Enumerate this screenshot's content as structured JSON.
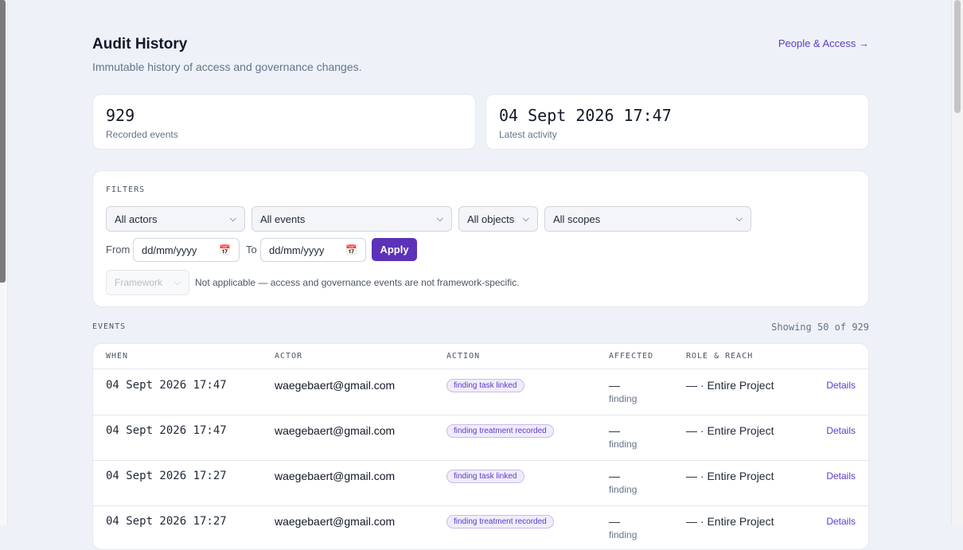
{
  "header": {
    "title": "Audit History",
    "subtitle": "Immutable history of access and governance changes.",
    "people_link": "People & Access →"
  },
  "stats": [
    {
      "value": "929",
      "label": "Recorded events"
    },
    {
      "value": "04 Sept 2026 17:47",
      "label": "Latest activity"
    }
  ],
  "filters": {
    "caption": "FILTERS",
    "actor": "All actors",
    "event": "All events",
    "object": "All objects",
    "scope": "All scopes",
    "from_label": "From",
    "from_placeholder": "dd/mm/yyyy",
    "to_label": "To",
    "to_placeholder": "dd/mm/yyyy",
    "apply_label": "Apply",
    "framework": "Framework",
    "framework_note": "Not applicable — access and governance events are not framework-specific."
  },
  "events": {
    "caption": "EVENTS",
    "showing": "Showing 50 of 929",
    "columns": [
      "WHEN",
      "ACTOR",
      "ACTION",
      "AFFECTED",
      "ROLE & REACH"
    ],
    "rows": [
      {
        "when": "04 Sept 2026 17:47",
        "actor": "waegebaert@gmail.com",
        "action": "finding task linked",
        "affected": "—",
        "affected_type": "finding",
        "role": "— · Entire Project",
        "details": "Details"
      },
      {
        "when": "04 Sept 2026 17:47",
        "actor": "waegebaert@gmail.com",
        "action": "finding treatment recorded",
        "affected": "—",
        "affected_type": "finding",
        "role": "— · Entire Project",
        "details": "Details"
      },
      {
        "when": "04 Sept 2026 17:27",
        "actor": "waegebaert@gmail.com",
        "action": "finding task linked",
        "affected": "—",
        "affected_type": "finding",
        "role": "— · Entire Project",
        "details": "Details"
      },
      {
        "when": "04 Sept 2026 17:27",
        "actor": "waegebaert@gmail.com",
        "action": "finding treatment recorded",
        "affected": "—",
        "affected_type": "finding",
        "role": "— · Entire Project",
        "details": "Details"
      }
    ]
  },
  "icons": {
    "dropdown": "chevron-down-icon",
    "date": "calendar-icon"
  },
  "colors": {
    "accent": "#5b32b8",
    "background": "#eef2f8",
    "badge_bg": "#f1ecfc"
  }
}
